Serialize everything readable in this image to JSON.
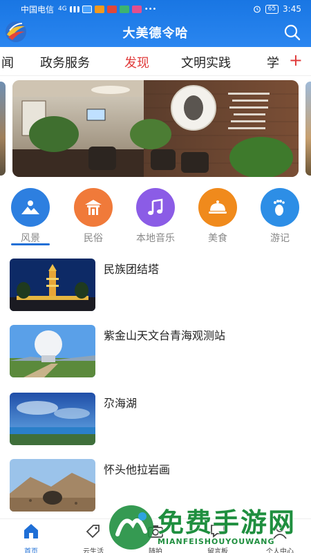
{
  "status_bar": {
    "carrier": "中国电信",
    "network": "4G",
    "battery": "65",
    "time": "3:45"
  },
  "header": {
    "title": "大美德令哈",
    "logo_icon": "city-logo-icon",
    "search_icon": "search-icon"
  },
  "tabs": {
    "items": [
      {
        "label": "闻",
        "active": false
      },
      {
        "label": "政务服务",
        "active": false
      },
      {
        "label": "发现",
        "active": true
      },
      {
        "label": "文明实践",
        "active": false
      },
      {
        "label": "学",
        "active": false
      }
    ],
    "add_label": "+",
    "active_color": "#e03a3a"
  },
  "categories": [
    {
      "label": "风景",
      "color": "#2d7fe0",
      "icon": "scenery-icon",
      "active": true
    },
    {
      "label": "民俗",
      "color": "#f07a3a",
      "icon": "folk-icon",
      "active": false
    },
    {
      "label": "本地音乐",
      "color": "#8b5ce6",
      "icon": "music-icon",
      "active": false
    },
    {
      "label": "美食",
      "color": "#f08a1c",
      "icon": "food-icon",
      "active": false
    },
    {
      "label": "游记",
      "color": "#2d8ee6",
      "icon": "footprint-icon",
      "active": false
    }
  ],
  "list": [
    {
      "title": "民族团结塔"
    },
    {
      "title": "紫金山天文台青海观测站"
    },
    {
      "title": "尕海湖"
    },
    {
      "title": "怀头他拉岩画"
    }
  ],
  "bottom_nav": [
    {
      "label": "首页",
      "icon": "home-icon",
      "active": true
    },
    {
      "label": "云生活",
      "icon": "tag-icon",
      "active": false
    },
    {
      "label": "随拍",
      "icon": "camera-icon",
      "active": false
    },
    {
      "label": "留言板",
      "icon": "message-icon",
      "active": false
    },
    {
      "label": "个人中心",
      "icon": "user-icon",
      "active": false
    }
  ],
  "watermark": {
    "main": "免费手游网",
    "sub": "MIANFEISHOUYOUWANG"
  },
  "colors": {
    "header_blue": "#1976e3",
    "accent_blue": "#1f6fd6",
    "watermark_green": "#1f8f3f"
  }
}
